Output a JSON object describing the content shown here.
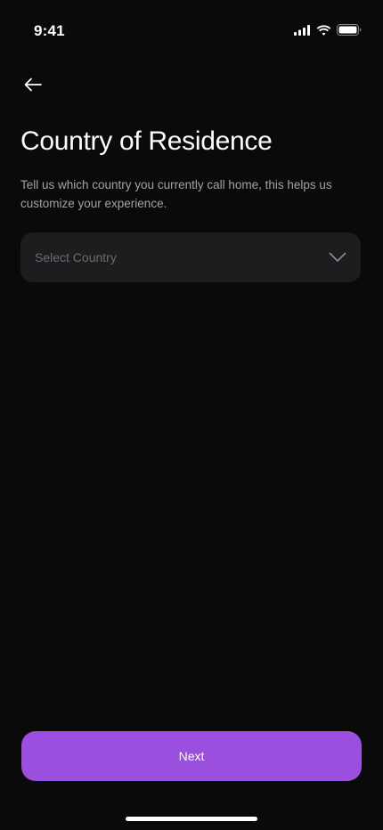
{
  "status_bar": {
    "time": "9:41",
    "icons": [
      "cellular-signal-icon",
      "wifi-icon",
      "battery-icon"
    ]
  },
  "header": {
    "back_icon": "arrow-left-icon"
  },
  "main": {
    "title": "Country of Residence",
    "subtitle": "Tell us which country you currently call home, this helps us customize your experience.",
    "country_select": {
      "placeholder": "Select Country",
      "icon": "chevron-down-icon"
    }
  },
  "footer": {
    "next_label": "Next"
  },
  "colors": {
    "background": "#0a0a0a",
    "field_background": "#1d1d1f",
    "accent": "#9b4fdf",
    "text_primary": "#ffffff",
    "text_secondary": "#a3a3a3",
    "placeholder": "#6c6c70"
  }
}
